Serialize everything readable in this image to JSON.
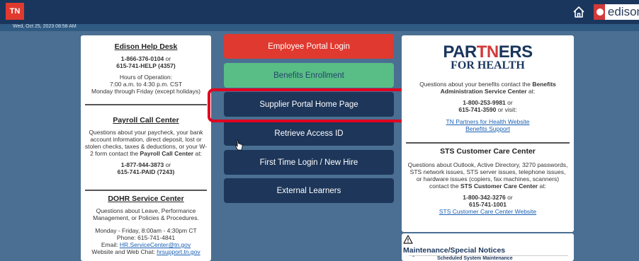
{
  "header": {
    "logo_text": "TN",
    "brand_text": "edison",
    "date": "Wed, Oct 25, 2023 08:58 AM"
  },
  "left": {
    "helpdesk": {
      "title": "Edison Help Desk",
      "phone1": "1-866-376-0104",
      "or": "or",
      "phone2": "615-741-HELP (4357)",
      "hours_label": "Hours of Operation:",
      "hours1": "7:00 a.m. to 4:30 p.m. CST",
      "hours2": "Monday through Friday (except holidays)"
    },
    "payroll": {
      "title": "Payroll Call Center",
      "text": "Questions about your paycheck, your bank account information, direct deposit, lost or stolen checks, taxes & deductions, or your W-2 form contact the",
      "bold": "Payroll Call Center",
      "at": "at:",
      "phone1": "1-877-944-3873",
      "or": "or",
      "phone2": "615-741-PAID (7243)"
    },
    "dohr": {
      "title": "DOHR Service Center",
      "text": "Questions about Leave, Performance Management, or Policies & Procedures.",
      "hours": "Monday - Friday, 8:00am - 4:30pm CT",
      "phone": "Phone: 615-741-4841",
      "email_label": "Email:",
      "email": "HR.ServiceCenter@tn.gov",
      "chat_label": "Website and Web Chat:",
      "chat": "hrsupport.tn.gov"
    }
  },
  "buttons": {
    "employee": "Employee Portal Login",
    "benefits": "Benefits Enrollment",
    "supplier": "Supplier Portal Home Page",
    "retrieve": "Retrieve Access ID",
    "first_time": "First Time Login / New Hire",
    "external": "External Learners"
  },
  "right": {
    "pfh": {
      "title_a": "PAR",
      "title_tn": "TN",
      "title_b": "ERS",
      "subtitle": "FOR HEALTH",
      "text": "Questions about your benefits contact the",
      "bold": "Benefits Administration Service Center",
      "at": "at:",
      "phone1": "1-800-253-9981",
      "or": "or",
      "phone2": "615-741-3590",
      "visit": "or visit:",
      "link1": "TN Partners for Health Website",
      "link2": "Benefits Support"
    },
    "sts": {
      "title": "STS Customer Care Center",
      "text": "Questions about Outlook, Active Directory, 3270 passwords, STS network issues, STS server issues, telephone issues, or hardware issues (copiers, fax machines, scanners) contact the",
      "bold": "STS Customer Care Center",
      "at": "at:",
      "phone1": "1-800-342-3276",
      "or": "or",
      "phone2": "615-741-1001",
      "link": "STS Customer Care Center Website"
    }
  },
  "notices": {
    "title": "Maintenance/Special Notices",
    "item": "Scheduled System Maintenance"
  },
  "colors": {
    "background": "#4a6f92",
    "topbar": "#1b365d",
    "accent_red": "#e0392f",
    "benefits_green": "#59bd86",
    "navy_button": "#1d3659",
    "highlight": "#e00020"
  }
}
